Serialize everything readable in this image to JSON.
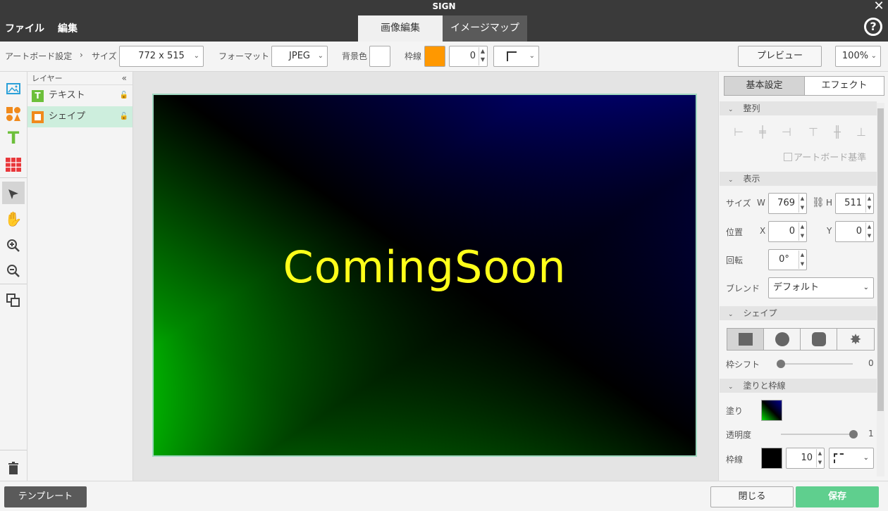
{
  "window": {
    "title": "SIGN"
  },
  "menu": {
    "file": "ファイル",
    "edit": "編集"
  },
  "tabs": {
    "image_edit": "画像編集",
    "image_map": "イメージマップ"
  },
  "toolbar": {
    "artboard_settings": "アートボード設定",
    "separator": "›",
    "size_label": "サイズ",
    "size_value": "772 x 515",
    "format_label": "フォーマット",
    "format_value": "JPEG",
    "bg_label": "背景色",
    "border_label": "枠線",
    "border_width": "0",
    "preview": "プレビュー",
    "zoom": "100%"
  },
  "colors": {
    "bg_color": "#ffffff",
    "border_color": "#ff9800",
    "text_color": "#ffff1a",
    "save_button": "#5fcf8e"
  },
  "layers": {
    "header": "レイヤー",
    "items": [
      {
        "name": "テキスト",
        "icon": "text-layer-icon",
        "selected": false
      },
      {
        "name": "シェイプ",
        "icon": "shape-layer-icon",
        "selected": true
      }
    ]
  },
  "artboard": {
    "text": "ComingSoon"
  },
  "panel": {
    "tabs": {
      "basic": "基本設定",
      "effect": "エフェクト"
    },
    "align": {
      "title": "整列",
      "artboard_base": "アートボード基準"
    },
    "display": {
      "title": "表示",
      "size_label": "サイズ",
      "w_label": "W",
      "w_value": "769",
      "h_label": "H",
      "h_value": "511",
      "position_label": "位置",
      "x_label": "X",
      "x_value": "0",
      "y_label": "Y",
      "y_value": "0",
      "rotate_label": "回転",
      "rotate_value": "0°",
      "blend_label": "ブレンド",
      "blend_value": "デフォルト"
    },
    "shape": {
      "title": "シェイプ",
      "shift_label": "枠シフト",
      "shift_value": "0"
    },
    "fill": {
      "title": "塗りと枠線",
      "fill_label": "塗り",
      "opacity_label": "透明度",
      "opacity_value": "1",
      "border_label": "枠線",
      "border_width": "10"
    }
  },
  "bottom": {
    "template": "テンプレート",
    "close": "閉じる",
    "save": "保存"
  }
}
